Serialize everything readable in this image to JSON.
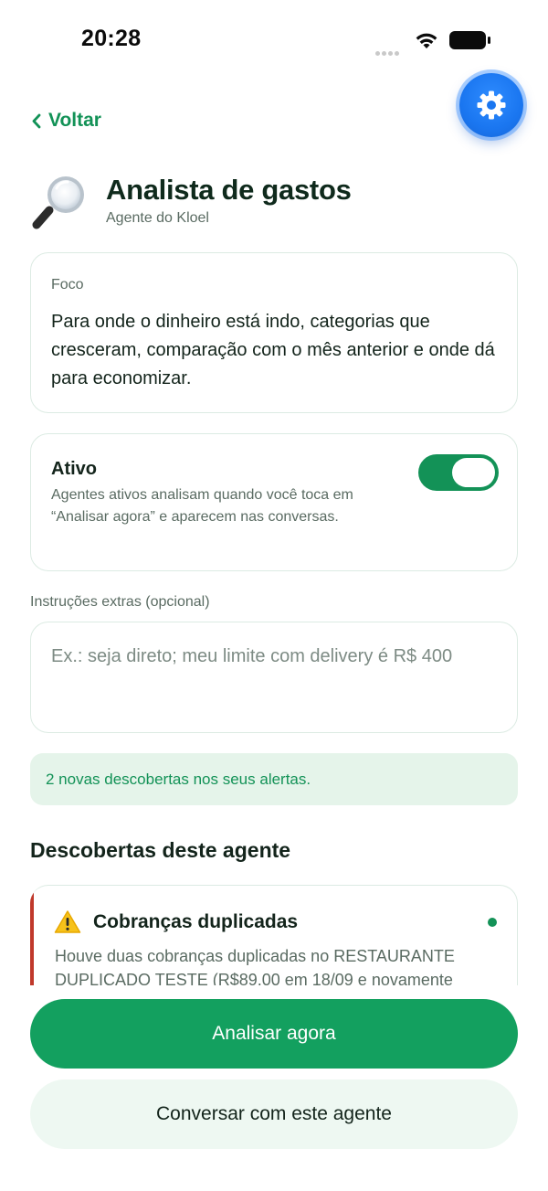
{
  "status_bar": {
    "time": "20:28",
    "icons": [
      "signal-dots-icon",
      "wifi-icon",
      "battery-icon"
    ]
  },
  "nav": {
    "back_label": "Voltar",
    "back_icon": "chevron-left-icon",
    "settings_icon": "gear-icon"
  },
  "agent": {
    "icon": "magnifying-glass-icon",
    "name": "Analista de gastos",
    "subtitle": "Agente do Kloel"
  },
  "focus": {
    "label": "Foco",
    "text": "Para onde o dinheiro está indo, categorias que cresceram, comparação com o mês anterior e onde dá para economizar."
  },
  "active": {
    "title": "Ativo",
    "description": "Agentes ativos analisam quando você toca em “Analisar agora” e aparecem nas conversas.",
    "enabled": true
  },
  "extras": {
    "label": "Instruções extras (opcional)",
    "value": "",
    "placeholder": "Ex.: seja direto; meu limite com delivery é R$ 400"
  },
  "alert": {
    "text": "2 novas descobertas nos seus alertas."
  },
  "discoveries": {
    "title": "Descobertas deste agente",
    "items": [
      {
        "icon": "warning-icon",
        "title": "Cobranças duplicadas",
        "text": "Houve duas cobranças duplicadas no RESTAURANTE DUPLICADO TESTE (R$89,00 em 18/09 e novamente",
        "unread": true
      }
    ]
  },
  "actions": {
    "analyze_label": "Analisar agora",
    "chat_label": "Conversar com este agente"
  },
  "colors": {
    "brand_green": "#139257",
    "button_green": "#13a05f",
    "alert_bg": "#e5f4ea",
    "fab_blue": "#1a76f0",
    "severity_red": "#c0392b"
  }
}
